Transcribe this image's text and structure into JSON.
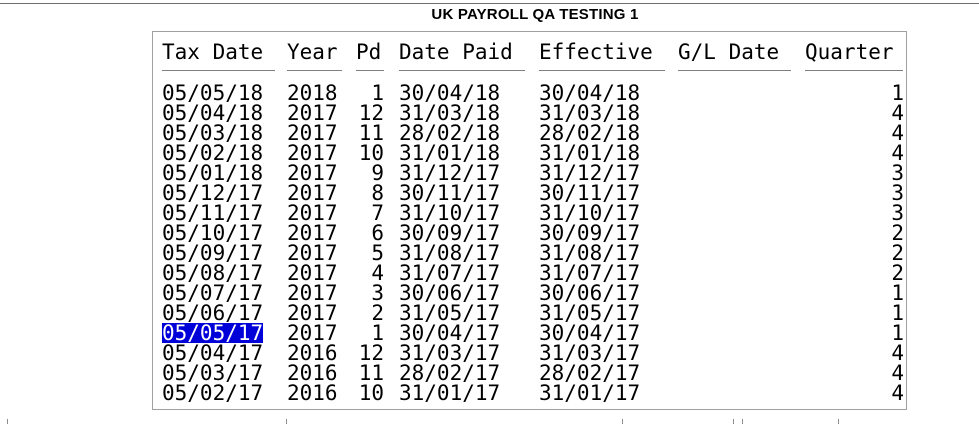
{
  "window": {
    "title": "UK PAYROLL QA TESTING 1"
  },
  "table": {
    "headers": {
      "tax_date": "Tax Date",
      "year": "Year",
      "pd": "Pd",
      "date_paid": "Date Paid",
      "effective": "Effective",
      "gl_date": "G/L Date",
      "quarter": "Quarter"
    },
    "rows": [
      {
        "tax_date": "05/05/18",
        "year": "2018",
        "pd": "1",
        "date_paid": "30/04/18",
        "effective": "30/04/18",
        "gl_date": "",
        "quarter": "1"
      },
      {
        "tax_date": "05/04/18",
        "year": "2017",
        "pd": "12",
        "date_paid": "31/03/18",
        "effective": "31/03/18",
        "gl_date": "",
        "quarter": "4"
      },
      {
        "tax_date": "05/03/18",
        "year": "2017",
        "pd": "11",
        "date_paid": "28/02/18",
        "effective": "28/02/18",
        "gl_date": "",
        "quarter": "4"
      },
      {
        "tax_date": "05/02/18",
        "year": "2017",
        "pd": "10",
        "date_paid": "31/01/18",
        "effective": "31/01/18",
        "gl_date": "",
        "quarter": "4"
      },
      {
        "tax_date": "05/01/18",
        "year": "2017",
        "pd": "9",
        "date_paid": "31/12/17",
        "effective": "31/12/17",
        "gl_date": "",
        "quarter": "3"
      },
      {
        "tax_date": "05/12/17",
        "year": "2017",
        "pd": "8",
        "date_paid": "30/11/17",
        "effective": "30/11/17",
        "gl_date": "",
        "quarter": "3"
      },
      {
        "tax_date": "05/11/17",
        "year": "2017",
        "pd": "7",
        "date_paid": "31/10/17",
        "effective": "31/10/17",
        "gl_date": "",
        "quarter": "3"
      },
      {
        "tax_date": "05/10/17",
        "year": "2017",
        "pd": "6",
        "date_paid": "30/09/17",
        "effective": "30/09/17",
        "gl_date": "",
        "quarter": "2"
      },
      {
        "tax_date": "05/09/17",
        "year": "2017",
        "pd": "5",
        "date_paid": "31/08/17",
        "effective": "31/08/17",
        "gl_date": "",
        "quarter": "2"
      },
      {
        "tax_date": "05/08/17",
        "year": "2017",
        "pd": "4",
        "date_paid": "31/07/17",
        "effective": "31/07/17",
        "gl_date": "",
        "quarter": "2"
      },
      {
        "tax_date": "05/07/17",
        "year": "2017",
        "pd": "3",
        "date_paid": "30/06/17",
        "effective": "30/06/17",
        "gl_date": "",
        "quarter": "1"
      },
      {
        "tax_date": "05/06/17",
        "year": "2017",
        "pd": "2",
        "date_paid": "31/05/17",
        "effective": "31/05/17",
        "gl_date": "",
        "quarter": "1"
      },
      {
        "tax_date": "05/05/17",
        "year": "2017",
        "pd": "1",
        "date_paid": "30/04/17",
        "effective": "30/04/17",
        "gl_date": "",
        "quarter": "1",
        "selected": true
      },
      {
        "tax_date": "05/04/17",
        "year": "2016",
        "pd": "12",
        "date_paid": "31/03/17",
        "effective": "31/03/17",
        "gl_date": "",
        "quarter": "4"
      },
      {
        "tax_date": "05/03/17",
        "year": "2016",
        "pd": "11",
        "date_paid": "28/02/17",
        "effective": "28/02/17",
        "gl_date": "",
        "quarter": "4"
      },
      {
        "tax_date": "05/02/17",
        "year": "2016",
        "pd": "10",
        "date_paid": "31/01/17",
        "effective": "31/01/17",
        "gl_date": "",
        "quarter": "4"
      }
    ]
  },
  "colors": {
    "selection_background": "#0000d8",
    "selection_text": "#ffffff",
    "border": "#a0a0a0"
  }
}
